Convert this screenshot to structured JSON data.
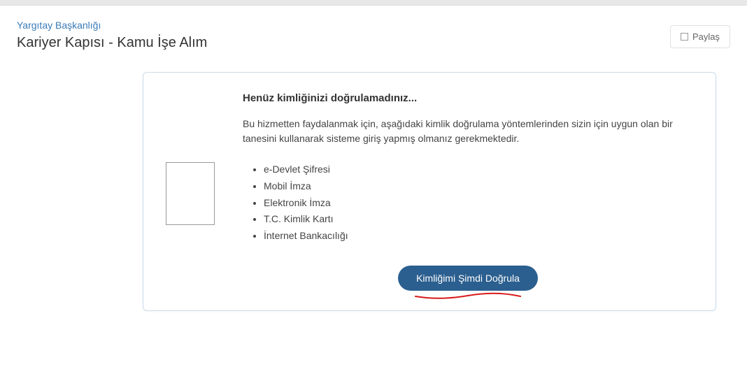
{
  "header": {
    "breadcrumb": "Yargıtay Başkanlığı",
    "title": "Kariyer Kapısı - Kamu İşe Alım",
    "share_label": "Paylaş"
  },
  "card": {
    "heading": "Henüz kimliğinizi doğrulamadınız...",
    "description": "Bu hizmetten faydalanmak için, aşağıdaki kimlik doğrulama yöntemlerinden sizin için uygun olan bir tanesini kullanarak sisteme giriş yapmış olmanız gerekmektedir.",
    "methods": [
      "e-Devlet Şifresi",
      "Mobil İmza",
      "Elektronik İmza",
      "T.C. Kimlik Kartı",
      "İnternet Bankacılığı"
    ],
    "verify_button": "Kimliğimi Şimdi Doğrula"
  }
}
